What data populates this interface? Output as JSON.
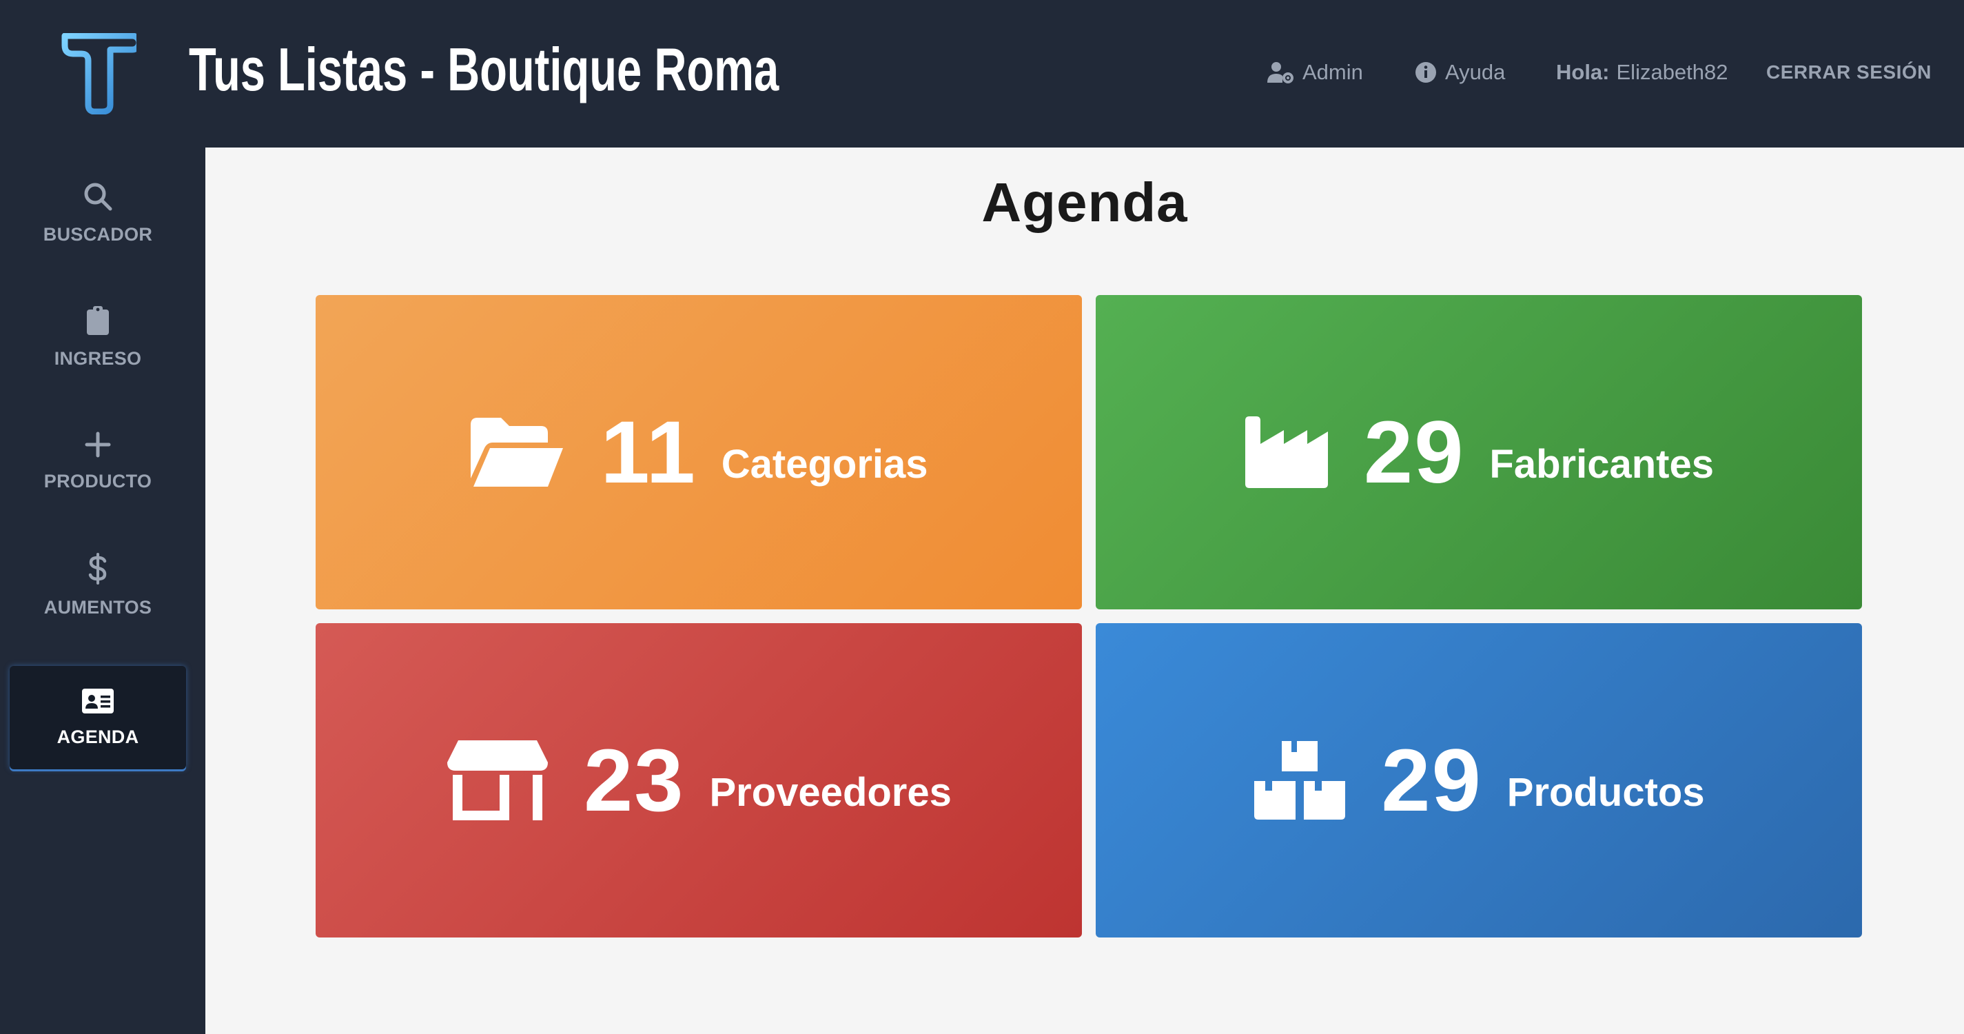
{
  "header": {
    "title": "Tus Listas - Boutique Roma",
    "admin_label": "Admin",
    "help_label": "Ayuda",
    "hello_prefix": "Hola:",
    "username": "Elizabeth82",
    "logout_label": "CERRAR SESIÓN"
  },
  "sidebar": {
    "items": [
      {
        "label": "BUSCADOR",
        "icon": "search-icon"
      },
      {
        "label": "INGRESO",
        "icon": "clipboard-icon"
      },
      {
        "label": "PRODUCTO",
        "icon": "plus-icon"
      },
      {
        "label": "AUMENTOS",
        "icon": "dollar-icon"
      },
      {
        "label": "AGENDA",
        "icon": "address-card-icon",
        "active": true
      }
    ]
  },
  "main": {
    "title": "Agenda",
    "cards": [
      {
        "count": "11",
        "label": "Categorias",
        "icon": "folder-open-icon",
        "color": "#f08c33"
      },
      {
        "count": "29",
        "label": "Fabricantes",
        "icon": "industry-icon",
        "color": "#3a8a36"
      },
      {
        "count": "23",
        "label": "Proveedores",
        "icon": "store-icon",
        "color": "#be3431"
      },
      {
        "count": "29",
        "label": "Productos",
        "icon": "boxes-icon",
        "color": "#2c69ad"
      }
    ]
  },
  "colors": {
    "header_bg": "#212938",
    "main_bg": "#f5f5f5",
    "active_accent": "#3d7ac4"
  }
}
